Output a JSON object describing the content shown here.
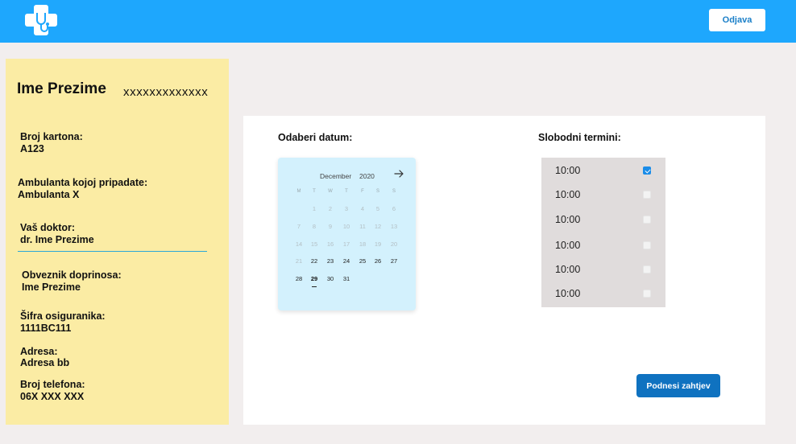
{
  "header": {
    "logout_label": "Odjava",
    "brand_color": "#1ea7fd"
  },
  "patient": {
    "name": "Ime Prezime",
    "id_number": "xxxxxxxxxxxxx",
    "fields": [
      {
        "label": "Broj kartona:",
        "value": "A123"
      },
      {
        "label": "Ambulanta kojoj pripadate:",
        "value": "Ambulanta X"
      },
      {
        "label": "Vaš doktor:",
        "value": "dr. Ime Prezime"
      },
      {
        "label": "Obveznik doprinosa:",
        "value": "Ime Prezime"
      },
      {
        "label": "Šifra osiguranika:",
        "value": "1111BC111"
      },
      {
        "label": "Adresa:",
        "value": "Adresa bb"
      },
      {
        "label": "Broj telefona:",
        "value": "06X XXX XXX"
      }
    ]
  },
  "booking": {
    "date_title": "Odaberi datum:",
    "slots_title": "Slobodni termini:",
    "submit_label": "Podnesi zahtjev",
    "calendar": {
      "month": "December",
      "year": "2020",
      "weekdays": [
        "M",
        "T",
        "W",
        "T",
        "F",
        "S",
        "S"
      ],
      "weeks": [
        [
          "",
          "1",
          "2",
          "3",
          "4",
          "5",
          "6"
        ],
        [
          "7",
          "8",
          "9",
          "10",
          "11",
          "12",
          "13"
        ],
        [
          "14",
          "15",
          "16",
          "17",
          "18",
          "19",
          "20"
        ],
        [
          "21",
          "22",
          "23",
          "24",
          "25",
          "26",
          "27"
        ],
        [
          "28",
          "29",
          "30",
          "31",
          "",
          "",
          ""
        ]
      ],
      "selected_day": "29",
      "first_available_day": "22"
    },
    "slots": [
      {
        "time": "10:00",
        "checked": true
      },
      {
        "time": "10:00",
        "checked": false
      },
      {
        "time": "10:00",
        "checked": false
      },
      {
        "time": "10:00",
        "checked": false
      },
      {
        "time": "10:00",
        "checked": false
      },
      {
        "time": "10:00",
        "checked": false
      }
    ]
  }
}
